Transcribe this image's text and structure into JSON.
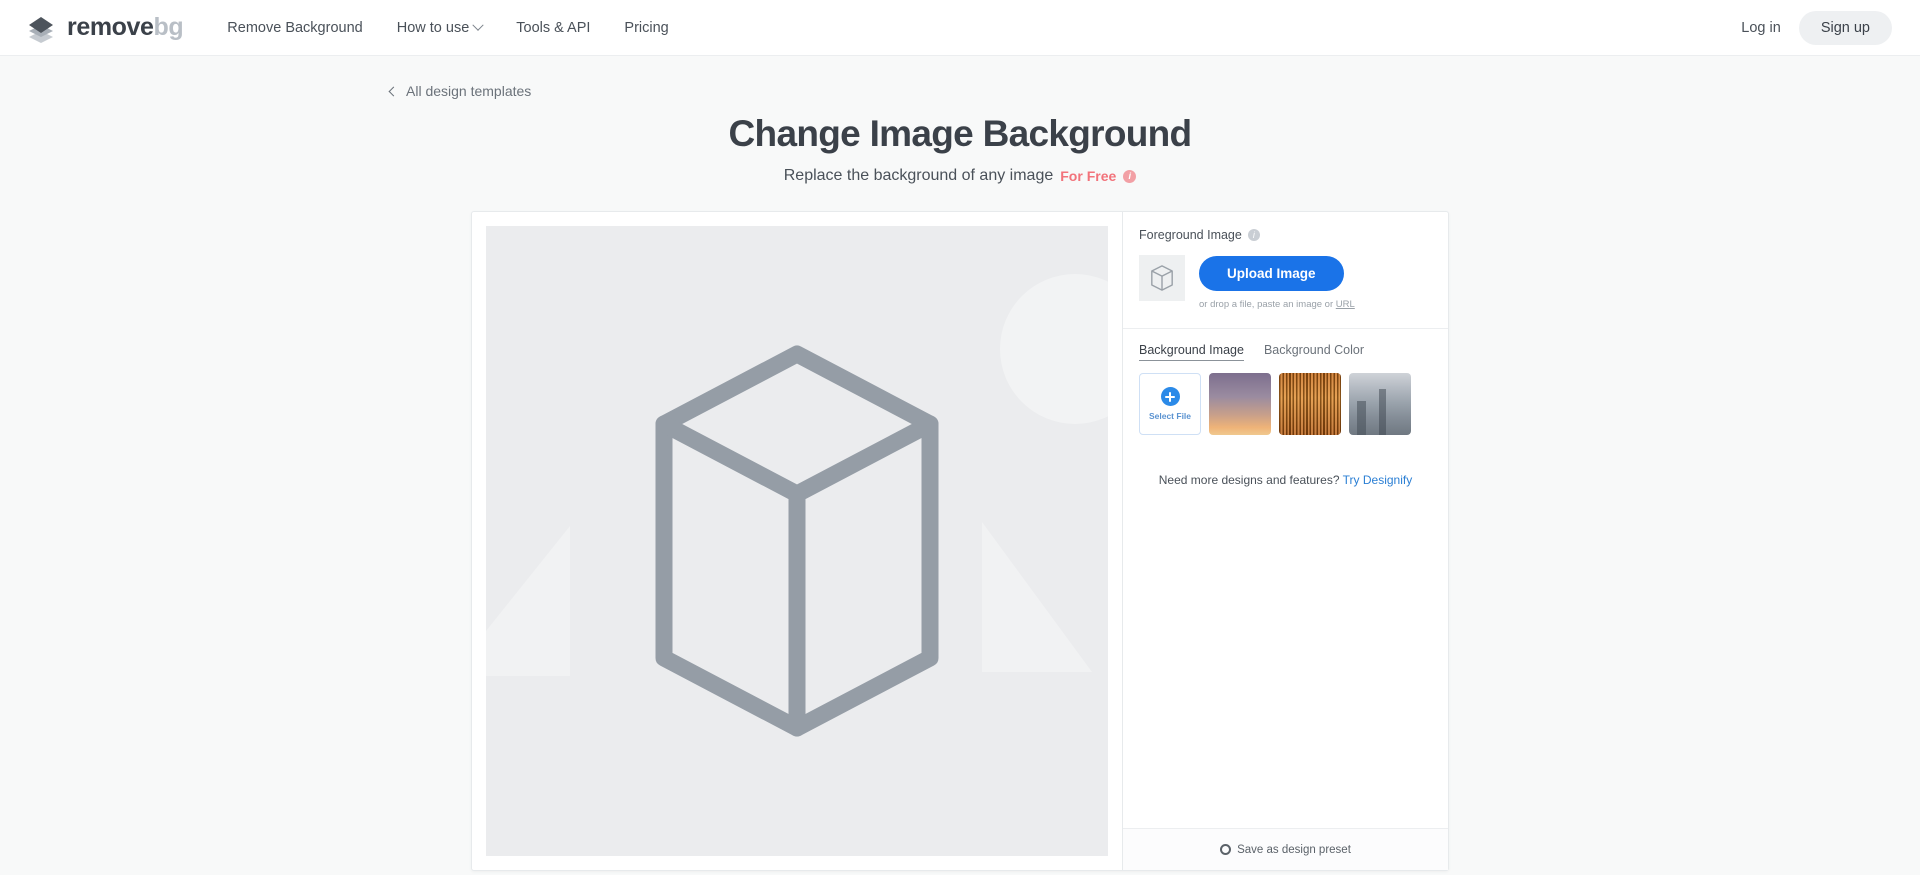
{
  "header": {
    "logo": {
      "primary": "remove",
      "secondary": "bg",
      "icon": "layers-diamond-icon"
    },
    "nav": [
      {
        "label": "Remove Background",
        "has_dropdown": false
      },
      {
        "label": "How to use",
        "has_dropdown": true
      },
      {
        "label": "Tools & API",
        "has_dropdown": false
      },
      {
        "label": "Pricing",
        "has_dropdown": false
      }
    ],
    "login_label": "Log in",
    "signup_label": "Sign up"
  },
  "page": {
    "back_link": "All design templates",
    "title": "Change Image Background",
    "subtitle": "Replace the background of any image",
    "free_badge": "For Free",
    "info_char": "i"
  },
  "editor": {
    "canvas": {
      "placeholder_icon": "hexagonal-prism-placeholder"
    },
    "foreground": {
      "label": "Foreground Image",
      "upload_button": "Upload Image",
      "drop_hint_prefix": "or drop a file, paste an image or ",
      "drop_hint_link": "URL"
    },
    "background_tabs": [
      {
        "label": "Background Image",
        "active": true
      },
      {
        "label": "Background Color",
        "active": false
      }
    ],
    "thumbnails": [
      {
        "name": "select-file",
        "label": "Select File"
      },
      {
        "name": "sunset-gradient",
        "label": ""
      },
      {
        "name": "orange-stripes",
        "label": ""
      },
      {
        "name": "cityscape",
        "label": ""
      }
    ],
    "designify_note": "Need more designs and features?",
    "designify_link": "Try Designify",
    "footer_action": "Save as design preset"
  },
  "colors": {
    "accent_blue": "#1a73e8",
    "link_blue": "#2b7fd4",
    "free_red": "#f2737b",
    "text_dark": "#3b4149",
    "page_bg": "#f8f9f9",
    "canvas_bg": "#ebecee",
    "prism_stroke": "#959da6"
  }
}
